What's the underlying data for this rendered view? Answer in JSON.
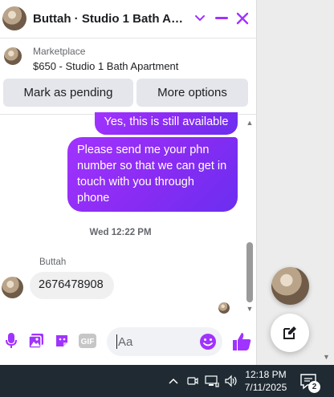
{
  "header": {
    "title": "Buttah · Studio 1 Bath Apa…",
    "icons": [
      "chevron-down-icon",
      "minimize-icon",
      "close-icon"
    ],
    "accent": "#a033ff"
  },
  "marketplace": {
    "label": "Marketplace",
    "item": "$650 - Studio 1 Bath Apartment"
  },
  "actions": {
    "mark_pending": "Mark as pending",
    "more_options": "More options"
  },
  "messages": {
    "outgoing": [
      "Yes, this is still available",
      "Please send me your phn number so that we can get in touch with you through phone"
    ],
    "timestamp": "Wed 12:22 PM",
    "incoming_sender": "Buttah",
    "incoming": "2676478908"
  },
  "composer": {
    "placeholder": "Aa",
    "icons": [
      "microphone-icon",
      "image-icon",
      "sticker-icon",
      "gif-icon",
      "emoji-icon",
      "thumbs-up-icon"
    ],
    "gif_label": "GIF"
  },
  "taskbar": {
    "time": "12:18 PM",
    "date": "7/11/2025",
    "notification_count": "2",
    "icons": [
      "chevron-up-icon",
      "meet-now-icon",
      "network-icon",
      "volume-icon",
      "notification-icon"
    ]
  }
}
